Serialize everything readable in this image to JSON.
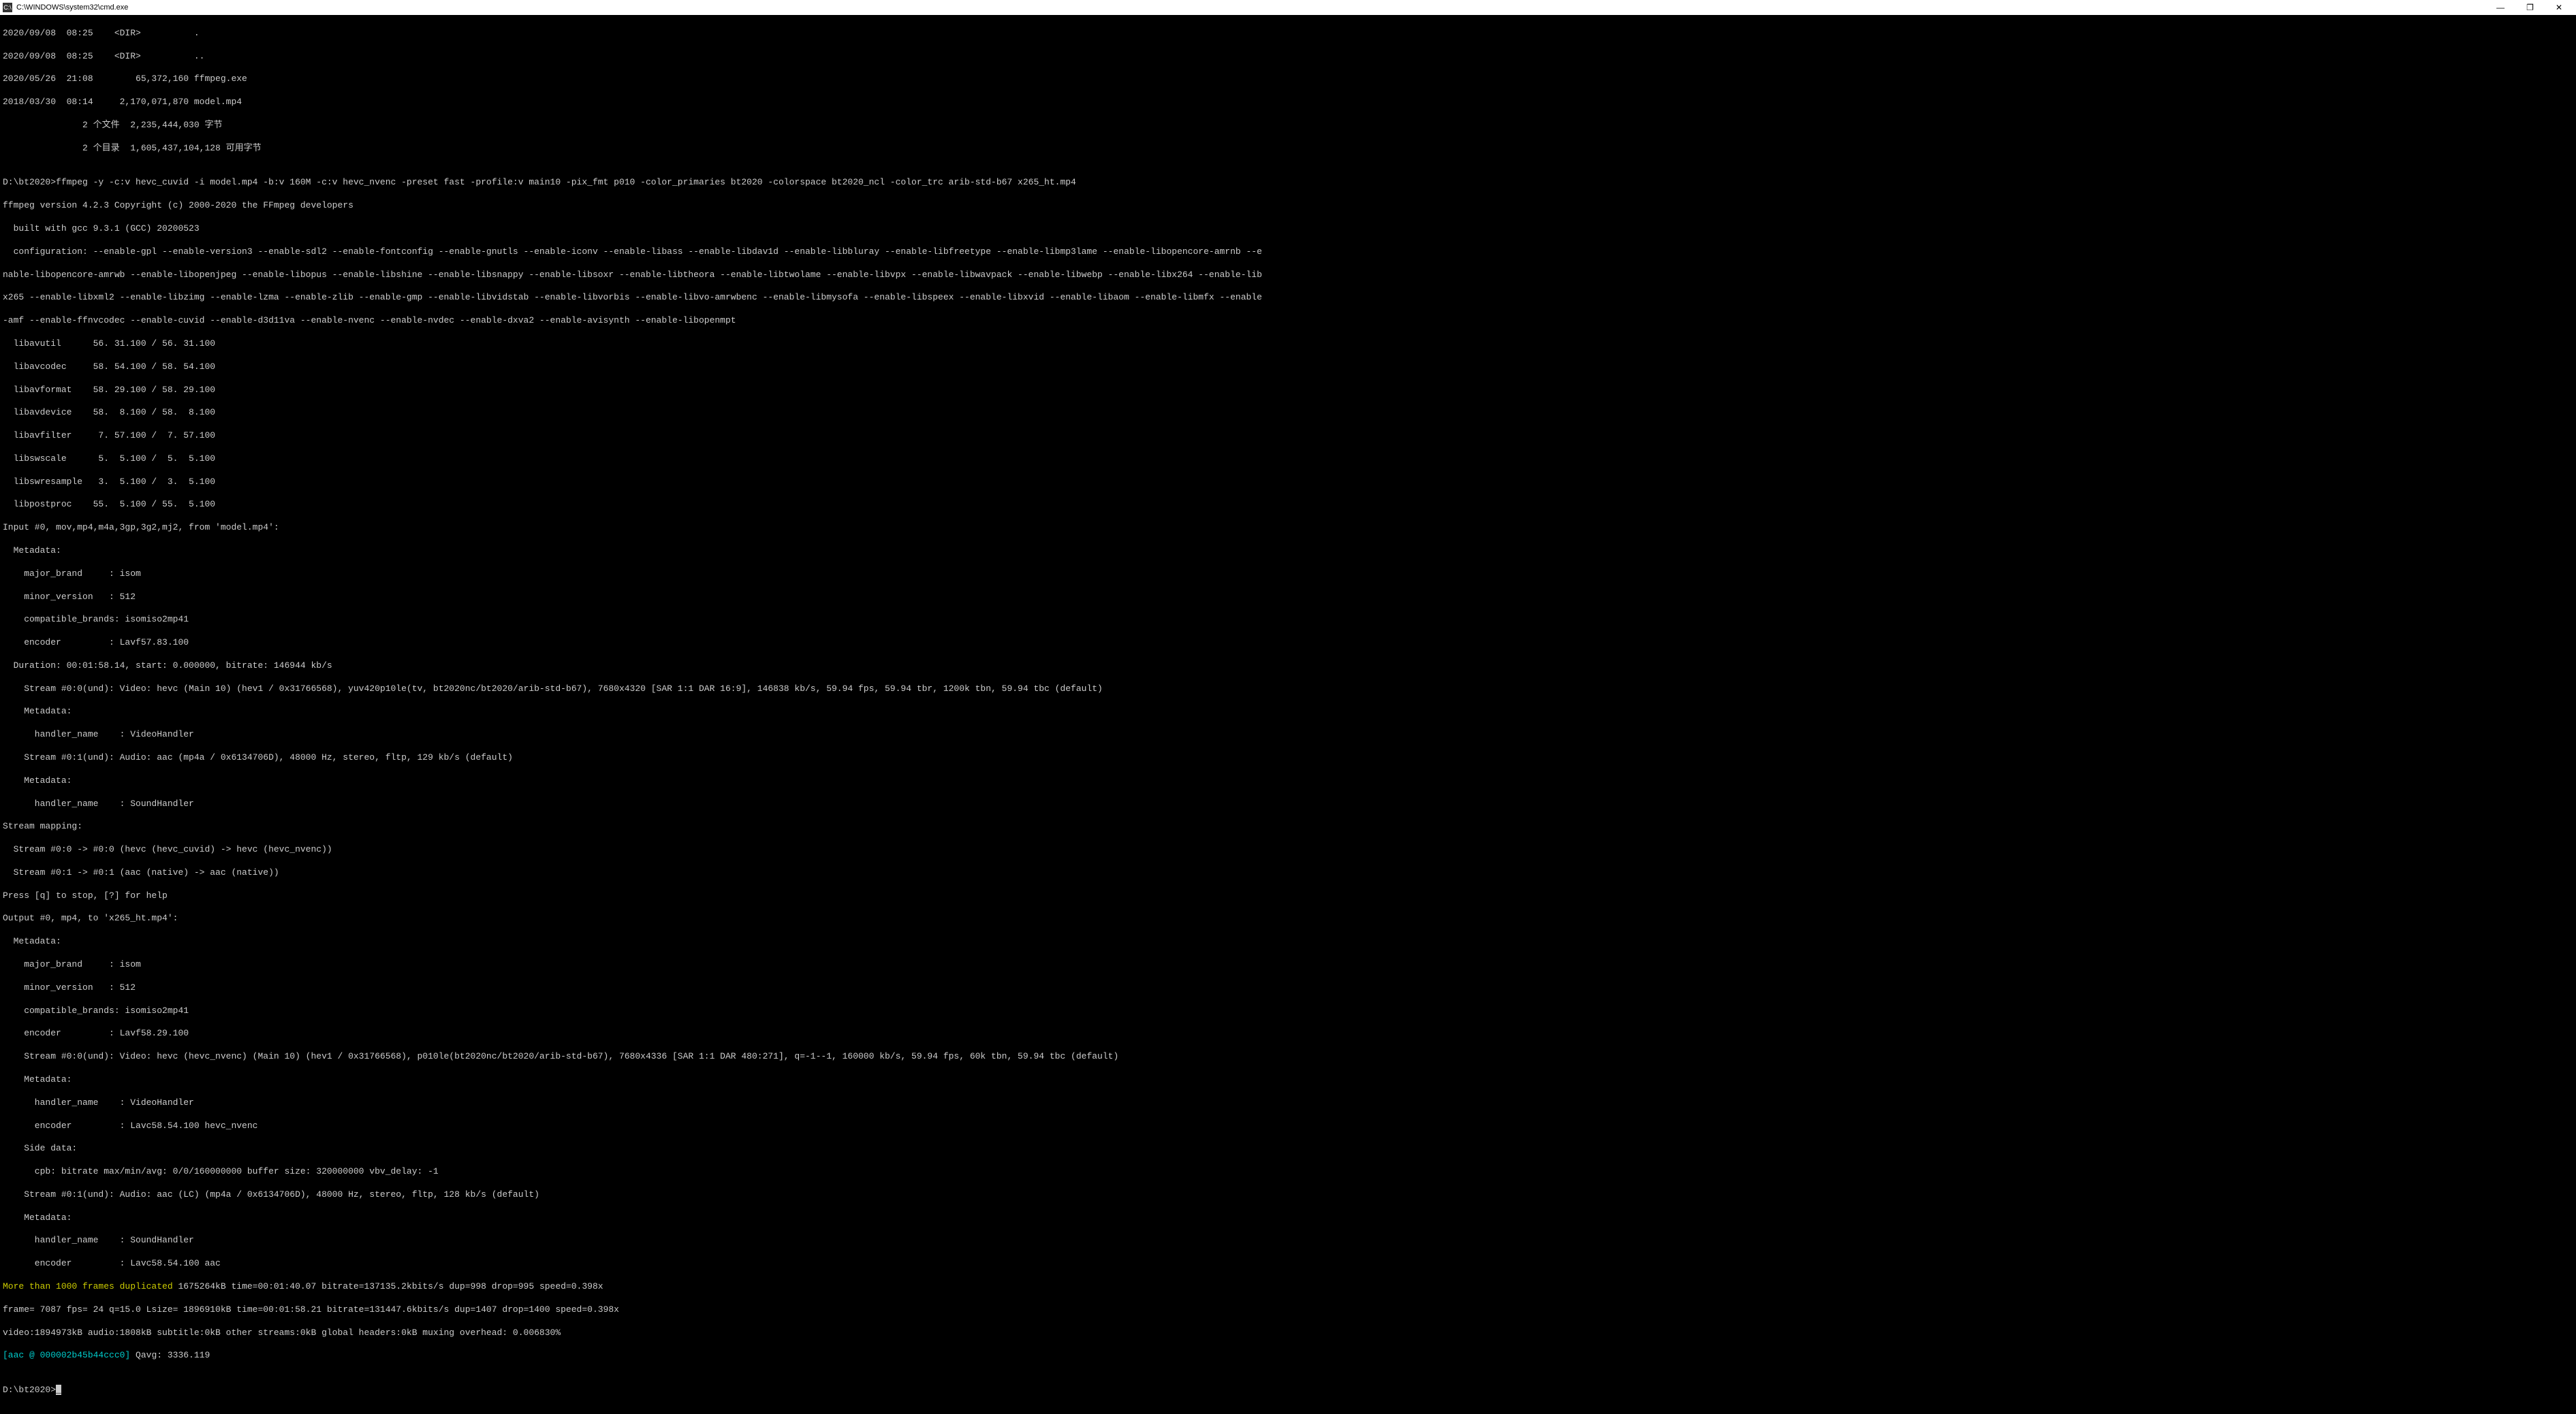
{
  "window": {
    "title": "C:\\WINDOWS\\system32\\cmd.exe",
    "icon_label": "C:\\."
  },
  "dir_listing": [
    "2020/09/08  08:25    <DIR>          .",
    "2020/09/08  08:25    <DIR>          ..",
    "2020/05/26  21:08        65,372,160 ffmpeg.exe",
    "2018/03/30  08:14     2,170,071,870 model.mp4",
    "               2 个文件  2,235,444,030 字节",
    "               2 个目录  1,605,437,104,128 可用字节"
  ],
  "blank1": "",
  "command_line": "D:\\bt2020>ffmpeg -y -c:v hevc_cuvid -i model.mp4 -b:v 160M -c:v hevc_nvenc -preset fast -profile:v main10 -pix_fmt p010 -color_primaries bt2020 -colorspace bt2020_ncl -color_trc arib-std-b67 x265_ht.mp4",
  "ffmpeg_header": [
    "ffmpeg version 4.2.3 Copyright (c) 2000-2020 the FFmpeg developers",
    "  built with gcc 9.3.1 (GCC) 20200523",
    "  configuration: --enable-gpl --enable-version3 --enable-sdl2 --enable-fontconfig --enable-gnutls --enable-iconv --enable-libass --enable-libdav1d --enable-libbluray --enable-libfreetype --enable-libmp3lame --enable-libopencore-amrnb --e",
    "nable-libopencore-amrwb --enable-libopenjpeg --enable-libopus --enable-libshine --enable-libsnappy --enable-libsoxr --enable-libtheora --enable-libtwolame --enable-libvpx --enable-libwavpack --enable-libwebp --enable-libx264 --enable-lib",
    "x265 --enable-libxml2 --enable-libzimg --enable-lzma --enable-zlib --enable-gmp --enable-libvidstab --enable-libvorbis --enable-libvo-amrwbenc --enable-libmysofa --enable-libspeex --enable-libxvid --enable-libaom --enable-libmfx --enable",
    "-amf --enable-ffnvcodec --enable-cuvid --enable-d3d11va --enable-nvenc --enable-nvdec --enable-dxva2 --enable-avisynth --enable-libopenmpt"
  ],
  "lib_versions": [
    "  libavutil      56. 31.100 / 56. 31.100",
    "  libavcodec     58. 54.100 / 58. 54.100",
    "  libavformat    58. 29.100 / 58. 29.100",
    "  libavdevice    58.  8.100 / 58.  8.100",
    "  libavfilter     7. 57.100 /  7. 57.100",
    "  libswscale      5.  5.100 /  5.  5.100",
    "  libswresample   3.  5.100 /  3.  5.100",
    "  libpostproc    55.  5.100 / 55.  5.100"
  ],
  "input_info": [
    "Input #0, mov,mp4,m4a,3gp,3g2,mj2, from 'model.mp4':",
    "  Metadata:",
    "    major_brand     : isom",
    "    minor_version   : 512",
    "    compatible_brands: isomiso2mp41",
    "    encoder         : Lavf57.83.100",
    "  Duration: 00:01:58.14, start: 0.000000, bitrate: 146944 kb/s",
    "    Stream #0:0(und): Video: hevc (Main 10) (hev1 / 0x31766568), yuv420p10le(tv, bt2020nc/bt2020/arib-std-b67), 7680x4320 [SAR 1:1 DAR 16:9], 146838 kb/s, 59.94 fps, 59.94 tbr, 1200k tbn, 59.94 tbc (default)",
    "    Metadata:",
    "      handler_name    : VideoHandler",
    "    Stream #0:1(und): Audio: aac (mp4a / 0x6134706D), 48000 Hz, stereo, fltp, 129 kb/s (default)",
    "    Metadata:",
    "      handler_name    : SoundHandler"
  ],
  "stream_mapping": [
    "Stream mapping:",
    "  Stream #0:0 -> #0:0 (hevc (hevc_cuvid) -> hevc (hevc_nvenc))",
    "  Stream #0:1 -> #0:1 (aac (native) -> aac (native))",
    "Press [q] to stop, [?] for help"
  ],
  "output_info": [
    "Output #0, mp4, to 'x265_ht.mp4':",
    "  Metadata:",
    "    major_brand     : isom",
    "    minor_version   : 512",
    "    compatible_brands: isomiso2mp41",
    "    encoder         : Lavf58.29.100",
    "    Stream #0:0(und): Video: hevc (hevc_nvenc) (Main 10) (hev1 / 0x31766568), p010le(bt2020nc/bt2020/arib-std-b67), 7680x4336 [SAR 1:1 DAR 480:271], q=-1--1, 160000 kb/s, 59.94 fps, 60k tbn, 59.94 tbc (default)",
    "    Metadata:",
    "      handler_name    : VideoHandler",
    "      encoder         : Lavc58.54.100 hevc_nvenc",
    "    Side data:",
    "      cpb: bitrate max/min/avg: 0/0/160000000 buffer size: 320000000 vbv_delay: -1",
    "    Stream #0:1(und): Audio: aac (LC) (mp4a / 0x6134706D), 48000 Hz, stereo, fltp, 128 kb/s (default)",
    "    Metadata:",
    "      handler_name    : SoundHandler",
    "      encoder         : Lavc58.54.100 aac"
  ],
  "warning_prefix": "More than 1000 frames duplicated ",
  "warning_suffix": "1675264kB time=00:01:40.07 bitrate=137135.2kbits/s dup=998 drop=995 speed=0.398x",
  "progress": [
    "frame= 7087 fps= 24 q=15.0 Lsize= 1896910kB time=00:01:58.21 bitrate=131447.6kbits/s dup=1407 drop=1400 speed=0.398x",
    "video:1894973kB audio:1808kB subtitle:0kB other streams:0kB global headers:0kB muxing overhead: 0.006830%"
  ],
  "aac_prefix": "[aac @ 000002b45b44ccc0] ",
  "aac_suffix": "Qavg: 3336.119",
  "blank2": "",
  "prompt": "D:\\bt2020>",
  "cursor": "_"
}
